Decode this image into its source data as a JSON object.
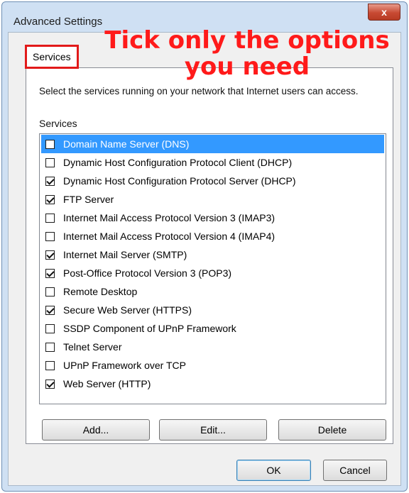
{
  "window": {
    "title": "Advanced Settings",
    "close_label": "x"
  },
  "tab": {
    "label": "Services"
  },
  "annotation": {
    "line1": "Tick only the options",
    "line2": "you need"
  },
  "description": "Select the services running on your network that Internet users can access.",
  "services_label": "Services",
  "services": [
    {
      "label": "Domain Name Server (DNS)",
      "checked": false,
      "selected": true
    },
    {
      "label": "Dynamic Host Configuration Protocol Client (DHCP)",
      "checked": false
    },
    {
      "label": "Dynamic Host Configuration Protocol Server (DHCP)",
      "checked": true
    },
    {
      "label": "FTP Server",
      "checked": true
    },
    {
      "label": "Internet Mail Access Protocol Version 3 (IMAP3)",
      "checked": false
    },
    {
      "label": "Internet Mail Access Protocol Version 4 (IMAP4)",
      "checked": false
    },
    {
      "label": "Internet Mail Server (SMTP)",
      "checked": true
    },
    {
      "label": "Post-Office Protocol Version 3 (POP3)",
      "checked": true
    },
    {
      "label": "Remote Desktop",
      "checked": false
    },
    {
      "label": "Secure Web Server (HTTPS)",
      "checked": true
    },
    {
      "label": "SSDP Component of UPnP Framework",
      "checked": false
    },
    {
      "label": "Telnet Server",
      "checked": false
    },
    {
      "label": "UPnP Framework over TCP",
      "checked": false
    },
    {
      "label": "Web Server (HTTP)",
      "checked": true
    }
  ],
  "buttons": {
    "add": "Add...",
    "edit": "Edit...",
    "delete": "Delete",
    "ok": "OK",
    "cancel": "Cancel"
  },
  "colors": {
    "annotation": "#ff1a1a",
    "selection": "#3399ff",
    "tab_highlight": "#e21a1a"
  }
}
